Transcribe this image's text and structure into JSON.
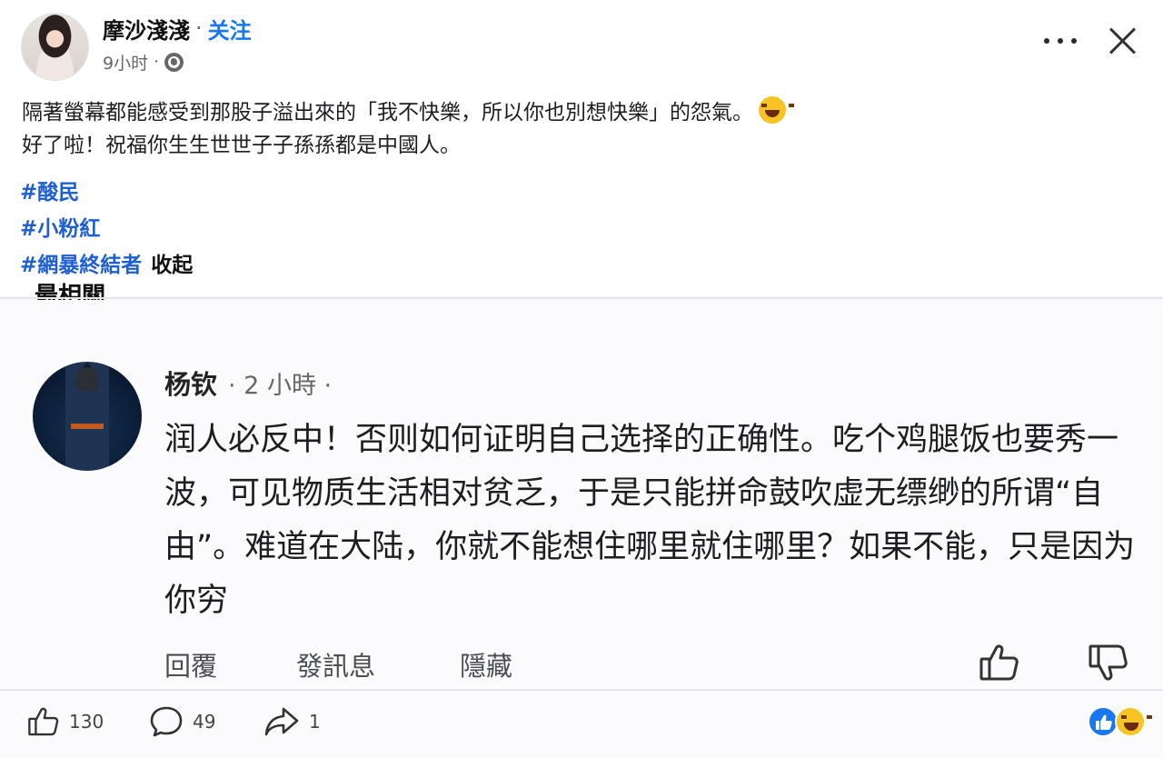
{
  "post": {
    "author": "摩沙淺淺",
    "separator": "·",
    "follow_label": "关注",
    "time": "9小时",
    "text_lines": [
      "隔著螢幕都能感受到那股子溢出來的「我不快樂，所以你也別想快樂」的怨氣。",
      "好了啦！祝福你生生世世子子孫孫都是中國人。"
    ],
    "hashtags": [
      "#酸民",
      "#小粉紅",
      "#網暴終結者"
    ],
    "collapse_label": "收起",
    "cut_off_label": "最相關"
  },
  "comment": {
    "name": "杨钦",
    "meta": "· 2 小時 ·",
    "text": "润人必反中！否则如何证明自己选择的正确性。吃个鸡腿饭也要秀一波，可见物质生活相对贫乏，于是只能拼命鼓吹虚无缥缈的所谓“自由”。难道在大陆，你就不能想住哪里就住哪里？如果不能，只是因为你穷",
    "actions": {
      "reply": "回覆",
      "message": "發訊息",
      "hide": "隱藏"
    }
  },
  "footer": {
    "like_count": "130",
    "comment_count": "49",
    "share_count": "1"
  },
  "icons": {
    "more": "more-dots-icon",
    "close": "close-icon",
    "globe": "globe-icon",
    "like": "thumbs-up-icon",
    "dislike": "thumbs-down-icon",
    "comment": "comment-bubble-icon",
    "share": "share-arrow-icon"
  },
  "colors": {
    "accent": "#1877f2",
    "hashtag": "#1f5fd1",
    "muted": "#65676b"
  }
}
